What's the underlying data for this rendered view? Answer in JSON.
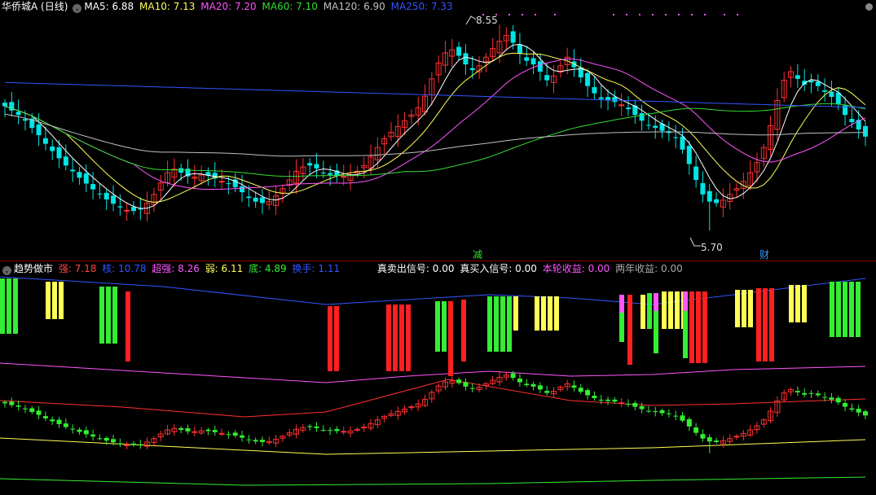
{
  "main": {
    "title": "华侨城A (日线)",
    "ma": [
      {
        "label": "MA5: 6.88",
        "color": "#ffffff"
      },
      {
        "label": "MA10: 7.13",
        "color": "#ffff55"
      },
      {
        "label": "MA20: 7.20",
        "color": "#ff55ff"
      },
      {
        "label": "MA60: 7.10",
        "color": "#33dd33"
      },
      {
        "label": "MA120: 6.90",
        "color": "#c0c0c0"
      },
      {
        "label": "MA250: 7.33",
        "color": "#3355ff"
      }
    ],
    "high_label": "8.55",
    "low_label": "5.70",
    "note_jian": "减",
    "note_cai": "财"
  },
  "indicator": {
    "title": "趋势做市",
    "stats": [
      {
        "label": "强: 7.18",
        "color": "#ff4444"
      },
      {
        "label": "核: 10.78",
        "color": "#3355ff"
      },
      {
        "label": "超强: 8.26",
        "color": "#ff55ff"
      },
      {
        "label": "弱: 6.11",
        "color": "#ffff55"
      },
      {
        "label": "底: 4.89",
        "color": "#33ee33"
      },
      {
        "label": "换手: 1.11",
        "color": "#3355ff"
      }
    ],
    "signals": [
      {
        "label": "真卖出信号: 0.00",
        "color": "#ffffff"
      },
      {
        "label": "真买入信号: 0.00",
        "color": "#ffffff"
      },
      {
        "label": "本轮收益: 0.00",
        "color": "#ff55ff"
      },
      {
        "label": "两年收益: 0.00",
        "color": "#aaaaaa"
      }
    ]
  },
  "chart_data": {
    "type": "candlestick",
    "price_range": [
      5.6,
      8.7
    ],
    "close_series": [
      7.42,
      7.36,
      7.3,
      7.22,
      7.12,
      7.02,
      6.9,
      6.8,
      6.7,
      6.6,
      6.52,
      6.43,
      6.35,
      6.27,
      6.2,
      6.13,
      6.07,
      6.02,
      5.98,
      5.97,
      5.99,
      6.08,
      6.2,
      6.36,
      6.5,
      6.55,
      6.5,
      6.45,
      6.44,
      6.47,
      6.46,
      6.42,
      6.38,
      6.35,
      6.3,
      6.23,
      6.15,
      6.1,
      6.08,
      6.1,
      6.18,
      6.28,
      6.4,
      6.52,
      6.58,
      6.6,
      6.56,
      6.5,
      6.47,
      6.46,
      6.45,
      6.47,
      6.52,
      6.6,
      6.72,
      6.85,
      6.97,
      7.06,
      7.14,
      7.22,
      7.3,
      7.4,
      7.56,
      7.8,
      8.02,
      8.16,
      8.2,
      8.12,
      8.0,
      7.92,
      7.98,
      8.1,
      8.22,
      8.32,
      8.4,
      8.3,
      8.15,
      8.05,
      8.0,
      7.9,
      7.78,
      7.84,
      7.98,
      8.1,
      7.96,
      7.82,
      7.7,
      7.6,
      7.52,
      7.5,
      7.48,
      7.44,
      7.38,
      7.3,
      7.22,
      7.16,
      7.12,
      7.08,
      7.05,
      6.98,
      6.82,
      6.62,
      6.4,
      6.2,
      6.1,
      6.08,
      6.12,
      6.2,
      6.28,
      6.38,
      6.5,
      6.64,
      6.85,
      7.15,
      7.5,
      7.78,
      7.9,
      7.8,
      7.72,
      7.75,
      7.7,
      7.62,
      7.55,
      7.45,
      7.3,
      7.2,
      7.1,
      7.0
    ],
    "ma_series_color": {
      "MA5": "#ffffff",
      "MA10": "#ffff55",
      "MA20": "#ff55ff",
      "MA60": "#33dd33",
      "MA120": "#c0c0c0",
      "MA250": "#3355ff"
    }
  }
}
